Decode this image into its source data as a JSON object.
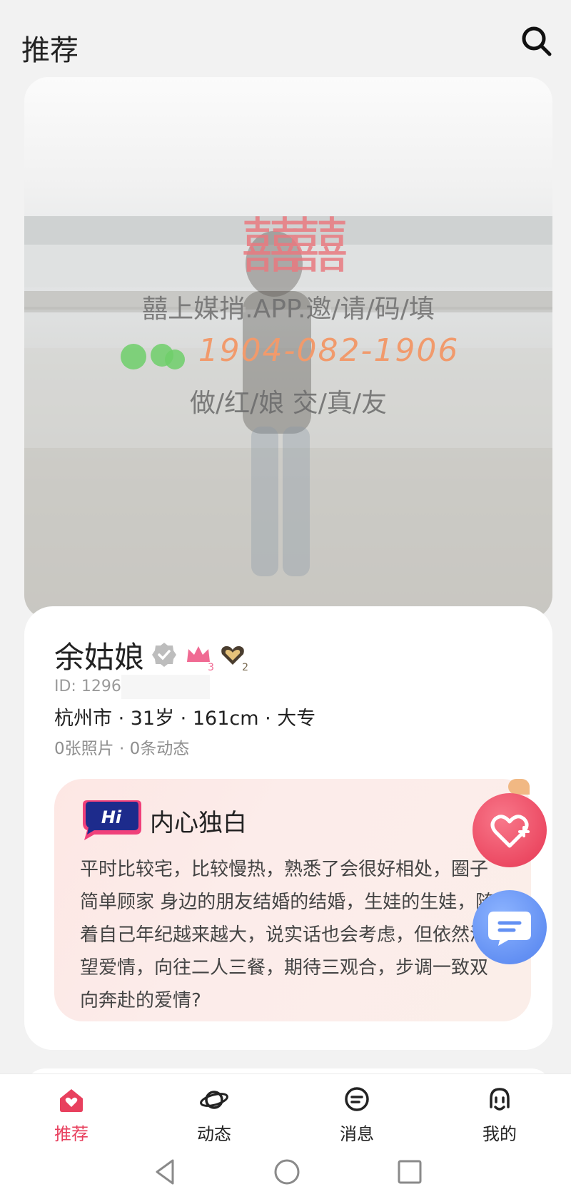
{
  "header": {
    "title": "推荐"
  },
  "photo": {
    "watermark_line1": "囍上媒捎.APP.邀/请/码/填",
    "watermark_phone": "1904-082-1906",
    "watermark_line3": "做/红/娘 交/真/友",
    "watermark_logo": "囍囍"
  },
  "profile": {
    "name": "余姑娘",
    "badge_crown_level": "3",
    "badge_heart_level": "2",
    "user_id": "ID: 1296",
    "basic_info": "杭州市 · 31岁 · 161cm · 大专",
    "counts": "0张照片 · 0条动态",
    "bio_badge": "Hi",
    "bio_title": "内心独白",
    "bio_text": "平时比较宅，比较慢热，熟悉了会很好相处，圈子简单顾家 身边的朋友结婚的结婚，生娃的生娃，随着自己年纪越来越大，说实话也会考虑，但依然渴望爱情，向往二人三餐，期待三观合，步调一致双向奔赴的爱情?"
  },
  "nav": {
    "items": [
      {
        "label": "推荐"
      },
      {
        "label": "动态"
      },
      {
        "label": "消息"
      },
      {
        "label": "我的"
      }
    ]
  },
  "colors": {
    "accent": "#e8405e",
    "chat": "#6390f3"
  }
}
